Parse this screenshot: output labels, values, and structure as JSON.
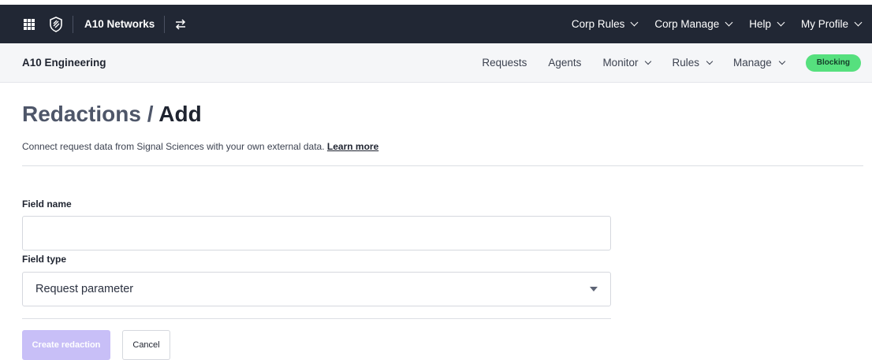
{
  "topbar": {
    "org_name": "A10 Networks",
    "menus": [
      {
        "label": "Corp Rules"
      },
      {
        "label": "Corp Manage"
      },
      {
        "label": "Help"
      },
      {
        "label": "My Profile"
      }
    ]
  },
  "subbar": {
    "site_name": "A10 Engineering",
    "nav": [
      {
        "label": "Requests"
      },
      {
        "label": "Agents"
      },
      {
        "label": "Monitor"
      },
      {
        "label": "Rules"
      },
      {
        "label": "Manage"
      }
    ],
    "status_badge": "Blocking"
  },
  "page": {
    "breadcrumb_parent": "Redactions",
    "breadcrumb_sep": " / ",
    "breadcrumb_current": "Add",
    "description": "Connect request data from Signal Sciences with your own external data. ",
    "learn_more": "Learn more"
  },
  "form": {
    "field_name_label": "Field name",
    "field_name_value": "",
    "field_type_label": "Field type",
    "field_type_selected": "Request parameter",
    "create_label": "Create redaction",
    "cancel_label": "Cancel"
  },
  "colors": {
    "topbar_bg": "#212734",
    "badge_green": "#56e07e",
    "primary_disabled": "#c8bff7"
  }
}
